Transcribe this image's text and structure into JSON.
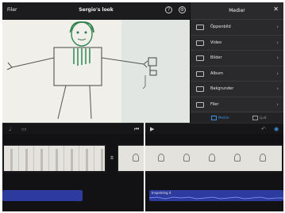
{
  "topbar": {
    "back_label": "Filer",
    "title": "Sergio's look"
  },
  "media": {
    "title": "Medier",
    "items": [
      {
        "label": "Öppenbild",
        "icon": "square-icon"
      },
      {
        "label": "Video",
        "icon": "film-icon"
      },
      {
        "label": "Bilder",
        "icon": "photo-icon"
      },
      {
        "label": "Album",
        "icon": "album-icon"
      },
      {
        "label": "Bakgrunder",
        "icon": "backgrounds-icon"
      },
      {
        "label": "Filer",
        "icon": "folder-icon"
      }
    ],
    "footer_tabs": [
      {
        "label": "Medier",
        "active": true
      },
      {
        "label": "Ljud",
        "active": false
      }
    ]
  },
  "timeline": {
    "audio_label": "Inspelning 4"
  },
  "colors": {
    "accent": "#3d8fe0",
    "audio": "#2d3a9e",
    "panel": "#2a2a2d",
    "background": "#1c1c1e"
  }
}
